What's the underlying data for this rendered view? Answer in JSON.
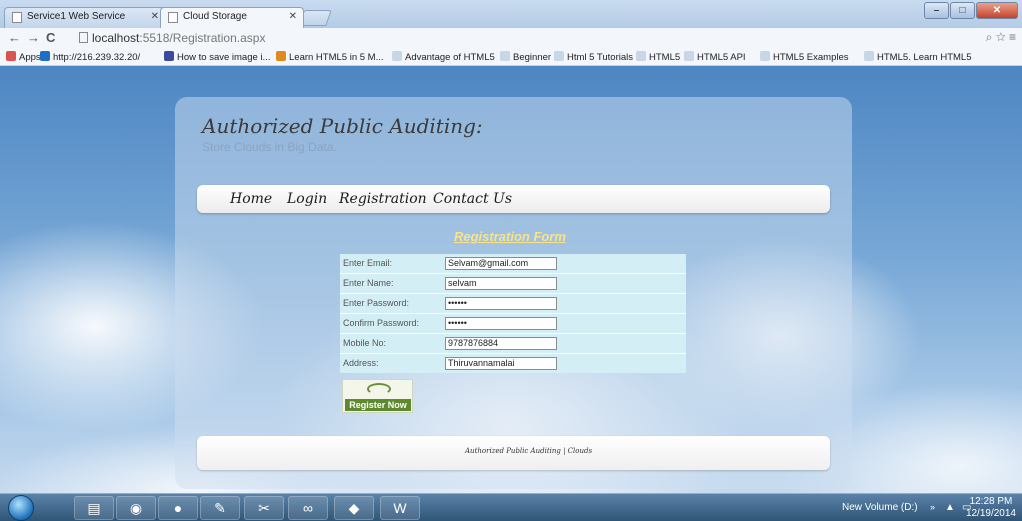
{
  "browser": {
    "tabs": [
      {
        "label": "Service1 Web Service",
        "active": false
      },
      {
        "label": "Cloud Storage",
        "active": true
      }
    ],
    "address": {
      "host": "localhost",
      "path": ":5518/Registration.aspx"
    },
    "bookmarks": [
      {
        "label": "Apps",
        "icon": "apps-icon",
        "color": "#d9534f"
      },
      {
        "label": "http://216.239.32.20/",
        "icon": "bing-icon",
        "color": "#1f6fc5"
      },
      {
        "label": "How to save image i...",
        "icon": "play-icon",
        "color": "#3b4a9c"
      },
      {
        "label": "Learn HTML5 in 5 M...",
        "icon": "flame-icon",
        "color": "#e08a1e"
      },
      {
        "label": "Advantage of HTML5",
        "icon": "page-icon",
        "color": "#c7d7e8"
      },
      {
        "label": "Beginner",
        "icon": "page-icon",
        "color": "#c7d7e8"
      },
      {
        "label": "Html 5 Tutorials",
        "icon": "page-icon",
        "color": "#c7d7e8"
      },
      {
        "label": "HTML5",
        "icon": "page-icon",
        "color": "#c7d7e8"
      },
      {
        "label": "HTML5 API",
        "icon": "page-icon",
        "color": "#c7d7e8"
      },
      {
        "label": "HTML5 Examples",
        "icon": "page-icon",
        "color": "#c7d7e8"
      },
      {
        "label": "HTML5. Learn HTML5",
        "icon": "page-icon",
        "color": "#c7d7e8"
      }
    ]
  },
  "site": {
    "brand": "Authorized Public Auditing:",
    "tagline": "Store Clouds in Big Data.",
    "nav": [
      "Home",
      "Login",
      "Registration",
      "Contact Us"
    ],
    "form_title": "Registration Form",
    "fields": [
      {
        "label": "Enter Email:",
        "value": "Selvam@gmail.com"
      },
      {
        "label": "Enter Name:",
        "value": "selvam"
      },
      {
        "label": "Enter Password:",
        "value": "••••••"
      },
      {
        "label": "Confirm Password:",
        "value": "••••••"
      },
      {
        "label": "Mobile No:",
        "value": "9787876884"
      },
      {
        "label": "Address:",
        "value": "Thiruvannamalai"
      }
    ],
    "register_button": "Register Now",
    "footer": "Authorized Public Auditing | Clouds"
  },
  "taskbar": {
    "drive": "New Volume (D:)",
    "time": "12:28 PM",
    "date": "12/19/2014"
  }
}
